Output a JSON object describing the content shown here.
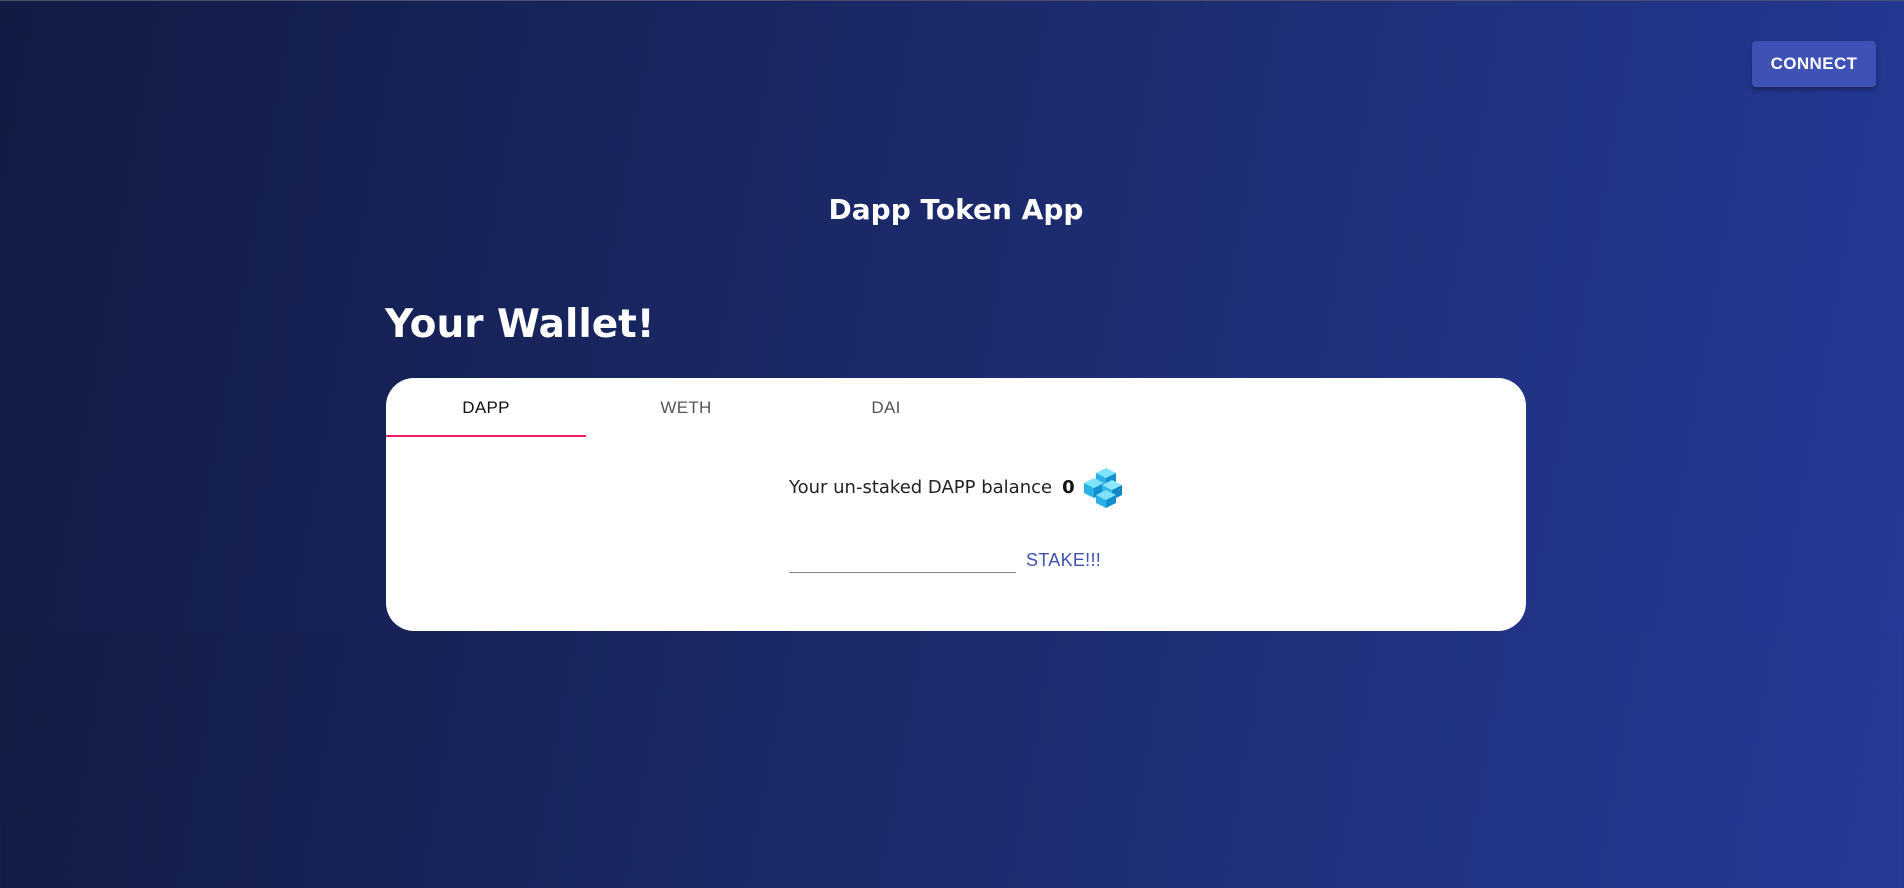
{
  "header": {
    "connect_label": "CONNECT"
  },
  "app": {
    "title": "Dapp Token App"
  },
  "wallet": {
    "heading": "Your Wallet!",
    "tabs": [
      {
        "label": "DAPP",
        "active": true
      },
      {
        "label": "WETH",
        "active": false
      },
      {
        "label": "DAI",
        "active": false
      }
    ],
    "balance_label": "Your un-staked DAPP balance",
    "balance_value": "0",
    "token_icon": "dapp-token-icon",
    "stake_input_value": "",
    "stake_label": "STAKE!!!"
  },
  "colors": {
    "accent": "#3f51b5",
    "tab_indicator": "#e91e63",
    "background_start": "#101a3f",
    "background_end": "#263a97"
  }
}
